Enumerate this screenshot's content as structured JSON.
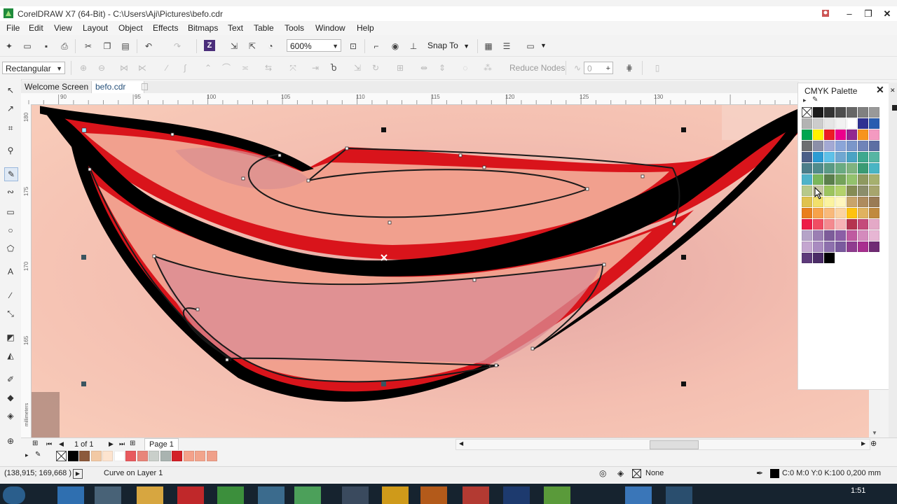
{
  "window": {
    "title": "CorelDRAW X7 (64-Bit) - C:\\Users\\Aji\\Pictures\\befo.cdr",
    "minimize": "–",
    "restore": "❐",
    "close": "✕",
    "app_icon": "coreldraw-logo-icon"
  },
  "menu": [
    "File",
    "Edit",
    "View",
    "Layout",
    "Object",
    "Effects",
    "Bitmaps",
    "Text",
    "Table",
    "Tools",
    "Window",
    "Help"
  ],
  "standard_toolbar": {
    "zoom_value": "600%",
    "snap_to_label": "Snap To"
  },
  "property_bar": {
    "mode_value": "Rectangular",
    "reduce_nodes_label": "Reduce Nodes",
    "smoothing_value": "0"
  },
  "doc_tabs": [
    "Welcome Screen",
    "befo.cdr"
  ],
  "ruler": {
    "h_labels": [
      "90",
      "95",
      "100",
      "105",
      "110",
      "115",
      "120",
      "125",
      "130"
    ],
    "v_labels": [
      "180",
      "175",
      "170",
      "165"
    ],
    "units": "millimeters"
  },
  "palette_docker": {
    "title": "CMYK Palette",
    "close": "✕",
    "swatches": [
      "none",
      "#1a1a1a",
      "#333333",
      "#4d4d4d",
      "#666666",
      "#808080",
      "#999999",
      "#b3b3b3",
      "#cccccc",
      "#e6e6e6",
      "#f2f2f2",
      "#ffffff",
      "#2e3192",
      "#2a5db0",
      "#00a650",
      "#fff200",
      "#ed1c24",
      "#ec008c",
      "#92278f",
      "#f7941d",
      "#f49ac1",
      "#6d6e71",
      "#8c8fa8",
      "#a3a9d4",
      "#8ba5d8",
      "#7a96c9",
      "#6f83b8",
      "#5d6fa3",
      "#4b5f88",
      "#2b9bd3",
      "#5ec1e8",
      "#6fa7d1",
      "#4aa3c4",
      "#3ea88f",
      "#56b5a3",
      "#4c7e8a",
      "#508b8b",
      "#5a9a85",
      "#6aab82",
      "#7fb37f",
      "#3a9b74",
      "#48b5c4",
      "#4fb3c9",
      "#79b65b",
      "#5b7f4c",
      "#74a35a",
      "#93c26d",
      "#8e9960",
      "#a6b06e",
      "#b7c98a",
      "#c7c7a2",
      "#9cc45e",
      "#b4d26b",
      "#858c55",
      "#8b8d6b",
      "#a7a56d",
      "#e0c24e",
      "#f2e06b",
      "#fbf3a0",
      "#fff6be",
      "#c8a46b",
      "#ae8b5e",
      "#9a7b55",
      "#e97f1e",
      "#f7a24a",
      "#f9b97a",
      "#fbd3a2",
      "#ffc20e",
      "#e0b25f",
      "#c08a3f",
      "#ed1c48",
      "#f04d63",
      "#f48a8f",
      "#f7b3b5",
      "#b5344f",
      "#c44a7a",
      "#e4a9c7",
      "#b5a3c8",
      "#9b7fb3",
      "#7d5c9a",
      "#8b5ea6",
      "#bf5aa0",
      "#d48bbd",
      "#e7b6d4",
      "#c4a6d0",
      "#a98bc0",
      "#8d70ad",
      "#7a5a9e",
      "#8f3c8f",
      "#a8308f",
      "#702b74",
      "#5d3a7a",
      "#4b2c67",
      "#000000"
    ]
  },
  "pages": {
    "page_counter": "1 of 1",
    "page_tab": "Page 1"
  },
  "document_palette": [
    "none",
    "#000000",
    "#8c5a3c",
    "#f2c9a4",
    "#fde4cf",
    "#ffffff",
    "#e85a5e",
    "#e8857a",
    "#c9cfca",
    "#a9b3b0",
    "#d32027",
    "#f4a18a",
    "#f2a48c",
    "#f0a08a"
  ],
  "status": {
    "cursor_position": "(138,915; 169,668 )",
    "object_info": "Curve on Layer 1",
    "fill_label": "None",
    "outline_info": "C:0 M:0 Y:0 K:100  0,200 mm",
    "outline_color": "#000000"
  },
  "taskbar": {
    "clock": "1:51"
  }
}
